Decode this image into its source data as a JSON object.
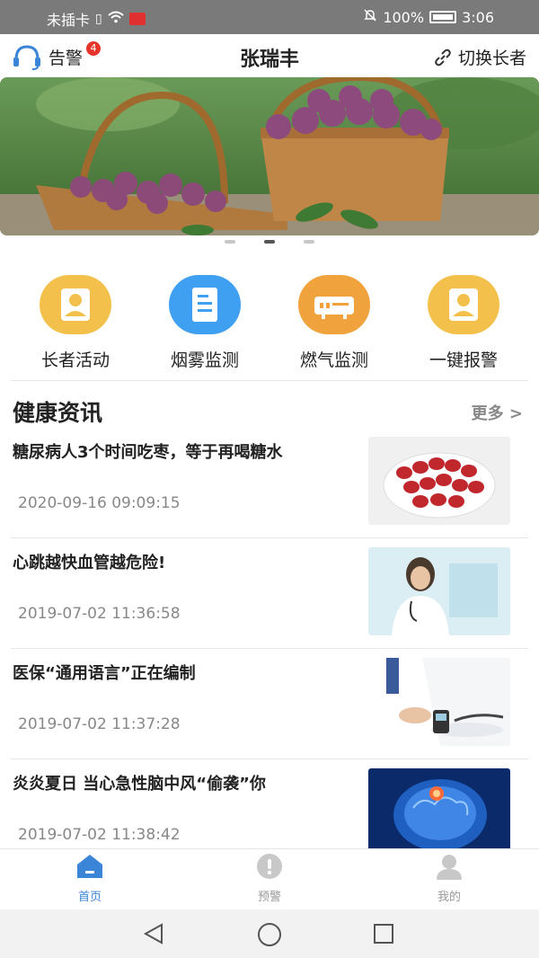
{
  "status_bar": {
    "carrier": "未插卡",
    "battery": "100%",
    "time": "3:06"
  },
  "header": {
    "alarm_label": "告警",
    "alarm_badge": "4",
    "title": "张瑞丰",
    "switch_label": "切换长者"
  },
  "banner": {
    "dots": 3,
    "active_dot": 1
  },
  "features": [
    {
      "label": "长者活动",
      "icon": "person-icon",
      "color": "#f3c04b"
    },
    {
      "label": "烟雾监测",
      "icon": "document-icon",
      "color": "#3f9ff0"
    },
    {
      "label": "燃气监测",
      "icon": "router-icon",
      "color": "#f0a23c"
    },
    {
      "label": "一键报警",
      "icon": "person-icon",
      "color": "#f3c04b"
    }
  ],
  "news": {
    "heading": "健康资讯",
    "more": "更多 >",
    "items": [
      {
        "title": "糖尿病人3个时间吃枣，等于再喝糖水",
        "time": "2020-09-16 09:09:15"
      },
      {
        "title": "心跳越快血管越危险!",
        "time": "2019-07-02 11:36:58"
      },
      {
        "title": "医保“通用语言”正在编制",
        "time": "2019-07-02 11:37:28"
      },
      {
        "title": "炎炎夏日 当心急性脑中风“偷袭”你",
        "time": "2019-07-02 11:38:42"
      }
    ]
  },
  "tabbar": {
    "tabs": [
      {
        "label": "首页",
        "active": true
      },
      {
        "label": "预警",
        "active": false
      },
      {
        "label": "我的",
        "active": false
      }
    ]
  },
  "colors": {
    "accent": "#3a85d8",
    "badge": "#e8352b"
  }
}
